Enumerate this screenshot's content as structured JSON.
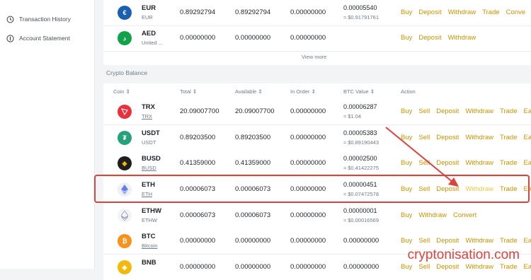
{
  "sidebar": {
    "items": [
      {
        "label": "Transaction History",
        "icon": "history-icon"
      },
      {
        "label": "Account Statement",
        "icon": "statement-icon"
      }
    ]
  },
  "fiat": {
    "rows": [
      {
        "symbol": "EUR",
        "name": "EUR",
        "total": "0.89292794",
        "available": "0.89292794",
        "in_order": "0.00000000",
        "btc1": "0.00005540",
        "btc2": "≈ $0.91791761",
        "actions": [
          "Buy",
          "Deposit",
          "Withdraw",
          "Trade",
          "Conve"
        ]
      },
      {
        "symbol": "AED",
        "name": "United ...",
        "total": "0.00000000",
        "available": "0.00000000",
        "in_order": "0.00000000",
        "btc1": "",
        "btc2": "",
        "actions": [
          "Buy",
          "Deposit",
          "Withdraw"
        ]
      }
    ],
    "view_more": "View more"
  },
  "crypto": {
    "section_title": "Crypto Balance",
    "headers": {
      "coin": "Coin ⇕",
      "total": "Total ⇕",
      "available": "Available ⇕",
      "in_order": "In Order ⇕",
      "btc_value": "BTC Value ⇕",
      "action": "Action"
    },
    "rows": [
      {
        "symbol": "TRX",
        "name": "TRX",
        "total": "20.09007700",
        "available": "20.09007700",
        "in_order": "0.00000000",
        "btc1": "0.00006287",
        "btc2": "≈ $1.04",
        "actions": [
          "Buy",
          "Sell",
          "Deposit",
          "Withdraw",
          "Trade",
          "Ea"
        ],
        "color": "#e8313c"
      },
      {
        "symbol": "USDT",
        "name": "USDT",
        "total": "0.89203500",
        "available": "0.89203500",
        "in_order": "0.00000000",
        "btc1": "0.00005383",
        "btc2": "≈ $0.89190443",
        "actions": [
          "Buy",
          "Sell",
          "Deposit",
          "Withdraw",
          "Trade",
          "Ea"
        ],
        "color": "#26a17b"
      },
      {
        "symbol": "BUSD",
        "name": "BUSD",
        "total": "0.41359000",
        "available": "0.41359000",
        "in_order": "0.00000000",
        "btc1": "0.00002500",
        "btc2": "≈ $0.41422275",
        "actions": [
          "Buy",
          "Sell",
          "Deposit",
          "Withdraw",
          "Trade",
          "Ea"
        ],
        "color": "#1e1e1e"
      },
      {
        "symbol": "ETH",
        "name": "ETH",
        "total": "0.00006073",
        "available": "0.00006073",
        "in_order": "0.00000000",
        "btc1": "0.00000451",
        "btc2": "≈ $0.07472578",
        "actions": [
          "Buy",
          "Sell",
          "Deposit",
          "Withdraw",
          "Trade",
          "Ea"
        ],
        "color": "#eef0f9"
      },
      {
        "symbol": "ETHW",
        "name": "ETHW",
        "total": "0.00006073",
        "available": "0.00006073",
        "in_order": "0.00000000",
        "btc1": "0.00000001",
        "btc2": "≈ $0.00016569",
        "actions": [
          "Buy",
          "Withdraw",
          "Convert"
        ],
        "color": "#f4f4f8"
      },
      {
        "symbol": "BTC",
        "name": "Bitcoin",
        "total": "0.00000000",
        "available": "0.00000000",
        "in_order": "0.00000000",
        "btc1": "0.00000000",
        "btc2": "",
        "actions": [
          "Buy",
          "Sell",
          "Deposit",
          "Withdraw",
          "Trade",
          "Ea"
        ],
        "color": "#f7931a"
      },
      {
        "symbol": "BNB",
        "name": "",
        "total": "0.00000000",
        "available": "0.00000000",
        "in_order": "0.00000000",
        "btc1": "0.00000000",
        "btc2": "",
        "actions": [
          "Buy",
          "Sell",
          "Deposit",
          "Withdraw",
          "Trade",
          "Ea"
        ],
        "color": "#f0b90b"
      }
    ]
  },
  "watermark": "cryptonisation.com"
}
